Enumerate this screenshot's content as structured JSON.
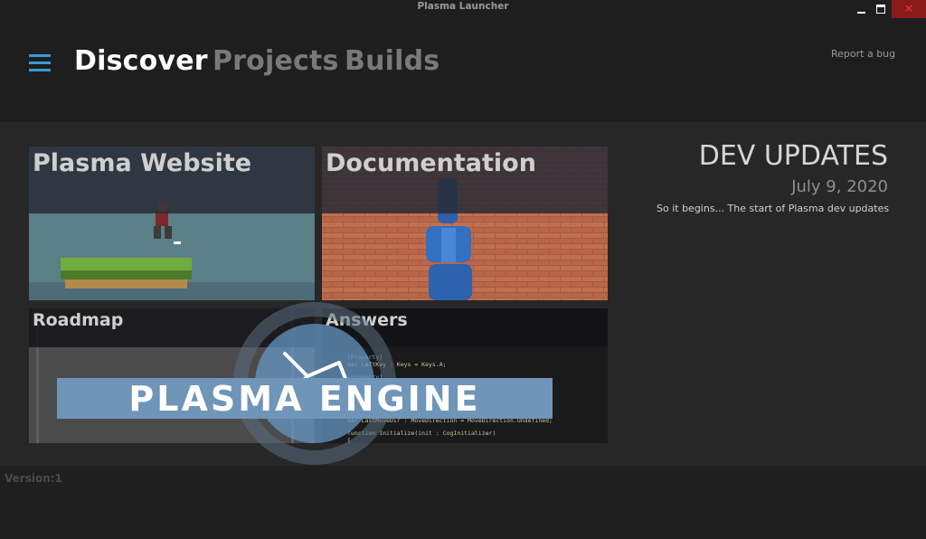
{
  "window": {
    "title": "Plasma Launcher"
  },
  "nav": {
    "discover": "Discover",
    "projects": "Projects",
    "builds": "Builds"
  },
  "report_bug": "Report a bug",
  "tiles": {
    "website": "Plasma Website",
    "documentation": "Documentation",
    "roadmap": "Roadmap",
    "answers": "Answers"
  },
  "banner": "PLASMA ENGINE",
  "updates": {
    "heading": "DEV UPDATES",
    "date": "July 9, 2020",
    "text": "So it begins... The start of Plasma dev updates"
  },
  "version": "Version:1",
  "colors": {
    "accent": "#3a9ad6",
    "close": "#8b1a1a"
  },
  "icons": [
    "menu-icon",
    "minimize-icon",
    "maximize-icon",
    "close-icon",
    "plasma-logo"
  ]
}
